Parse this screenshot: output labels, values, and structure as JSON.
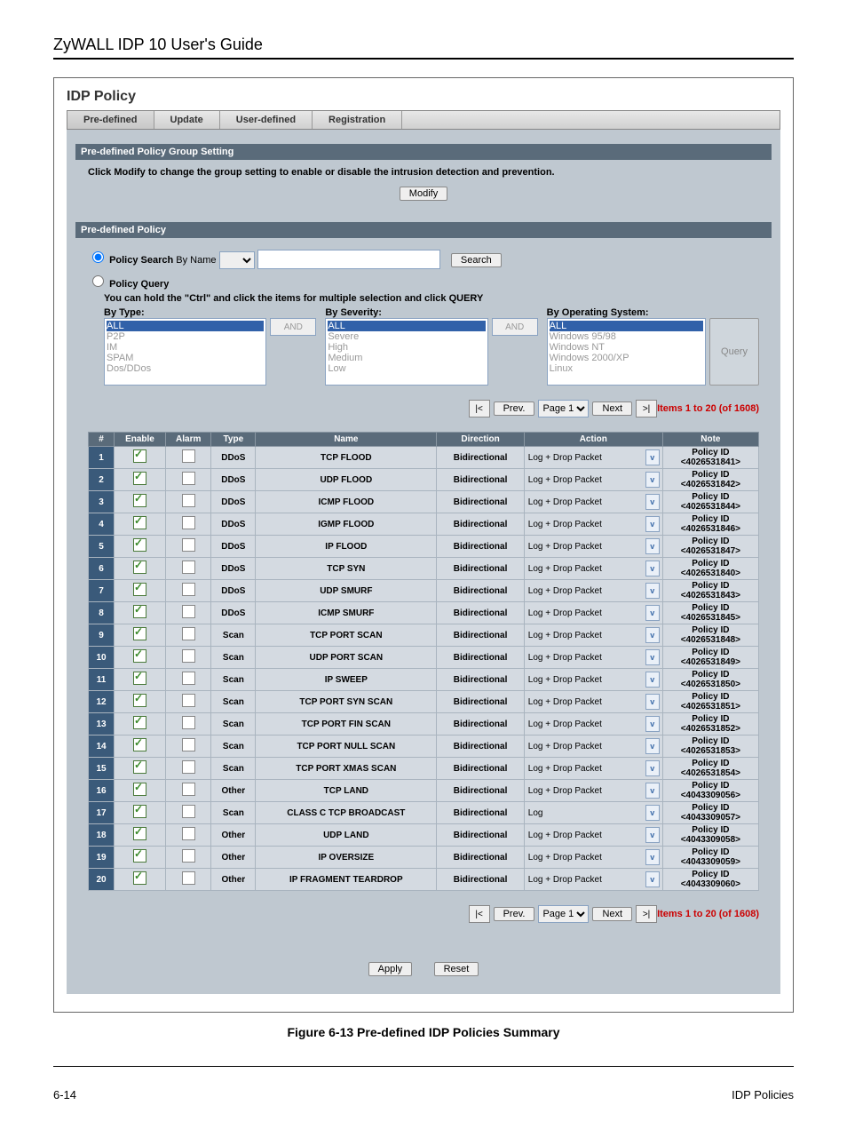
{
  "doc": {
    "guide_title": "ZyWALL IDP 10 User's Guide",
    "caption": "Figure 6-13 Pre-defined IDP Policies Summary",
    "page_left": "6-14",
    "page_right": "IDP Policies"
  },
  "app": {
    "title": "IDP Policy",
    "tabs": [
      "Pre-defined",
      "Update",
      "User-defined",
      "Registration"
    ]
  },
  "group": {
    "heading": "Pre-defined Policy Group Setting",
    "instruction": "Click Modify to change the group setting to enable or disable the intrusion detection and prevention.",
    "modify": "Modify"
  },
  "policy": {
    "heading": "Pre-defined Policy",
    "search_label": "Policy Search",
    "search_by": "By Name",
    "search_btn": "Search",
    "query_label": "Policy Query",
    "query_hint": "You can hold the \"Ctrl\" and click the items for multiple selection and click QUERY",
    "by_type": "By Type:",
    "by_severity": "By Severity:",
    "by_os": "By Operating System:",
    "and": "AND",
    "query_btn": "Query",
    "types": [
      "ALL",
      "P2P",
      "IM",
      "SPAM",
      "Dos/DDos"
    ],
    "severities": [
      "ALL",
      "Severe",
      "High",
      "Medium",
      "Low"
    ],
    "oss": [
      "ALL",
      "Windows 95/98",
      "Windows NT",
      "Windows 2000/XP",
      "Linux"
    ]
  },
  "pager": {
    "first": "|<",
    "prev": "Prev.",
    "page": "Page 1",
    "next": "Next",
    "last": ">|",
    "items": "Items 1 to 20 (of 1608)"
  },
  "table": {
    "headers": [
      "#",
      "Enable",
      "Alarm",
      "Type",
      "Name",
      "Direction",
      "Action",
      "Note"
    ],
    "default_action": "Log + Drop Packet",
    "bidir": "Bidirectional",
    "rows": [
      {
        "n": 1,
        "t": "DDoS",
        "name": "TCP FLOOD",
        "act": "Log + Drop Packet",
        "id": "<4026531841>"
      },
      {
        "n": 2,
        "t": "DDoS",
        "name": "UDP FLOOD",
        "act": "Log + Drop Packet",
        "id": "<4026531842>"
      },
      {
        "n": 3,
        "t": "DDoS",
        "name": "ICMP FLOOD",
        "act": "Log + Drop Packet",
        "id": "<4026531844>"
      },
      {
        "n": 4,
        "t": "DDoS",
        "name": "IGMP FLOOD",
        "act": "Log + Drop Packet",
        "id": "<4026531846>"
      },
      {
        "n": 5,
        "t": "DDoS",
        "name": "IP FLOOD",
        "act": "Log + Drop Packet",
        "id": "<4026531847>"
      },
      {
        "n": 6,
        "t": "DDoS",
        "name": "TCP SYN",
        "act": "Log + Drop Packet",
        "id": "<4026531840>"
      },
      {
        "n": 7,
        "t": "DDoS",
        "name": "UDP SMURF",
        "act": "Log + Drop Packet",
        "id": "<4026531843>"
      },
      {
        "n": 8,
        "t": "DDoS",
        "name": "ICMP SMURF",
        "act": "Log + Drop Packet",
        "id": "<4026531845>"
      },
      {
        "n": 9,
        "t": "Scan",
        "name": "TCP PORT SCAN",
        "act": "Log + Drop Packet",
        "id": "<4026531848>"
      },
      {
        "n": 10,
        "t": "Scan",
        "name": "UDP PORT SCAN",
        "act": "Log + Drop Packet",
        "id": "<4026531849>"
      },
      {
        "n": 11,
        "t": "Scan",
        "name": "IP SWEEP",
        "act": "Log + Drop Packet",
        "id": "<4026531850>"
      },
      {
        "n": 12,
        "t": "Scan",
        "name": "TCP PORT SYN SCAN",
        "act": "Log + Drop Packet",
        "id": "<4026531851>"
      },
      {
        "n": 13,
        "t": "Scan",
        "name": "TCP PORT FIN SCAN",
        "act": "Log + Drop Packet",
        "id": "<4026531852>"
      },
      {
        "n": 14,
        "t": "Scan",
        "name": "TCP PORT NULL SCAN",
        "act": "Log + Drop Packet",
        "id": "<4026531853>"
      },
      {
        "n": 15,
        "t": "Scan",
        "name": "TCP PORT XMAS SCAN",
        "act": "Log + Drop Packet",
        "id": "<4026531854>"
      },
      {
        "n": 16,
        "t": "Other",
        "name": "TCP LAND",
        "act": "Log + Drop Packet",
        "id": "<4043309056>"
      },
      {
        "n": 17,
        "t": "Scan",
        "name": "CLASS C TCP BROADCAST",
        "act": "Log",
        "id": "<4043309057>"
      },
      {
        "n": 18,
        "t": "Other",
        "name": "UDP LAND",
        "act": "Log + Drop Packet",
        "id": "<4043309058>"
      },
      {
        "n": 19,
        "t": "Other",
        "name": "IP OVERSIZE",
        "act": "Log + Drop Packet",
        "id": "<4043309059>"
      },
      {
        "n": 20,
        "t": "Other",
        "name": "IP FRAGMENT TEARDROP",
        "act": "Log + Drop Packet",
        "id": "<4043309060>"
      }
    ],
    "policy_id_label": "Policy ID"
  },
  "buttons": {
    "apply": "Apply",
    "reset": "Reset"
  }
}
